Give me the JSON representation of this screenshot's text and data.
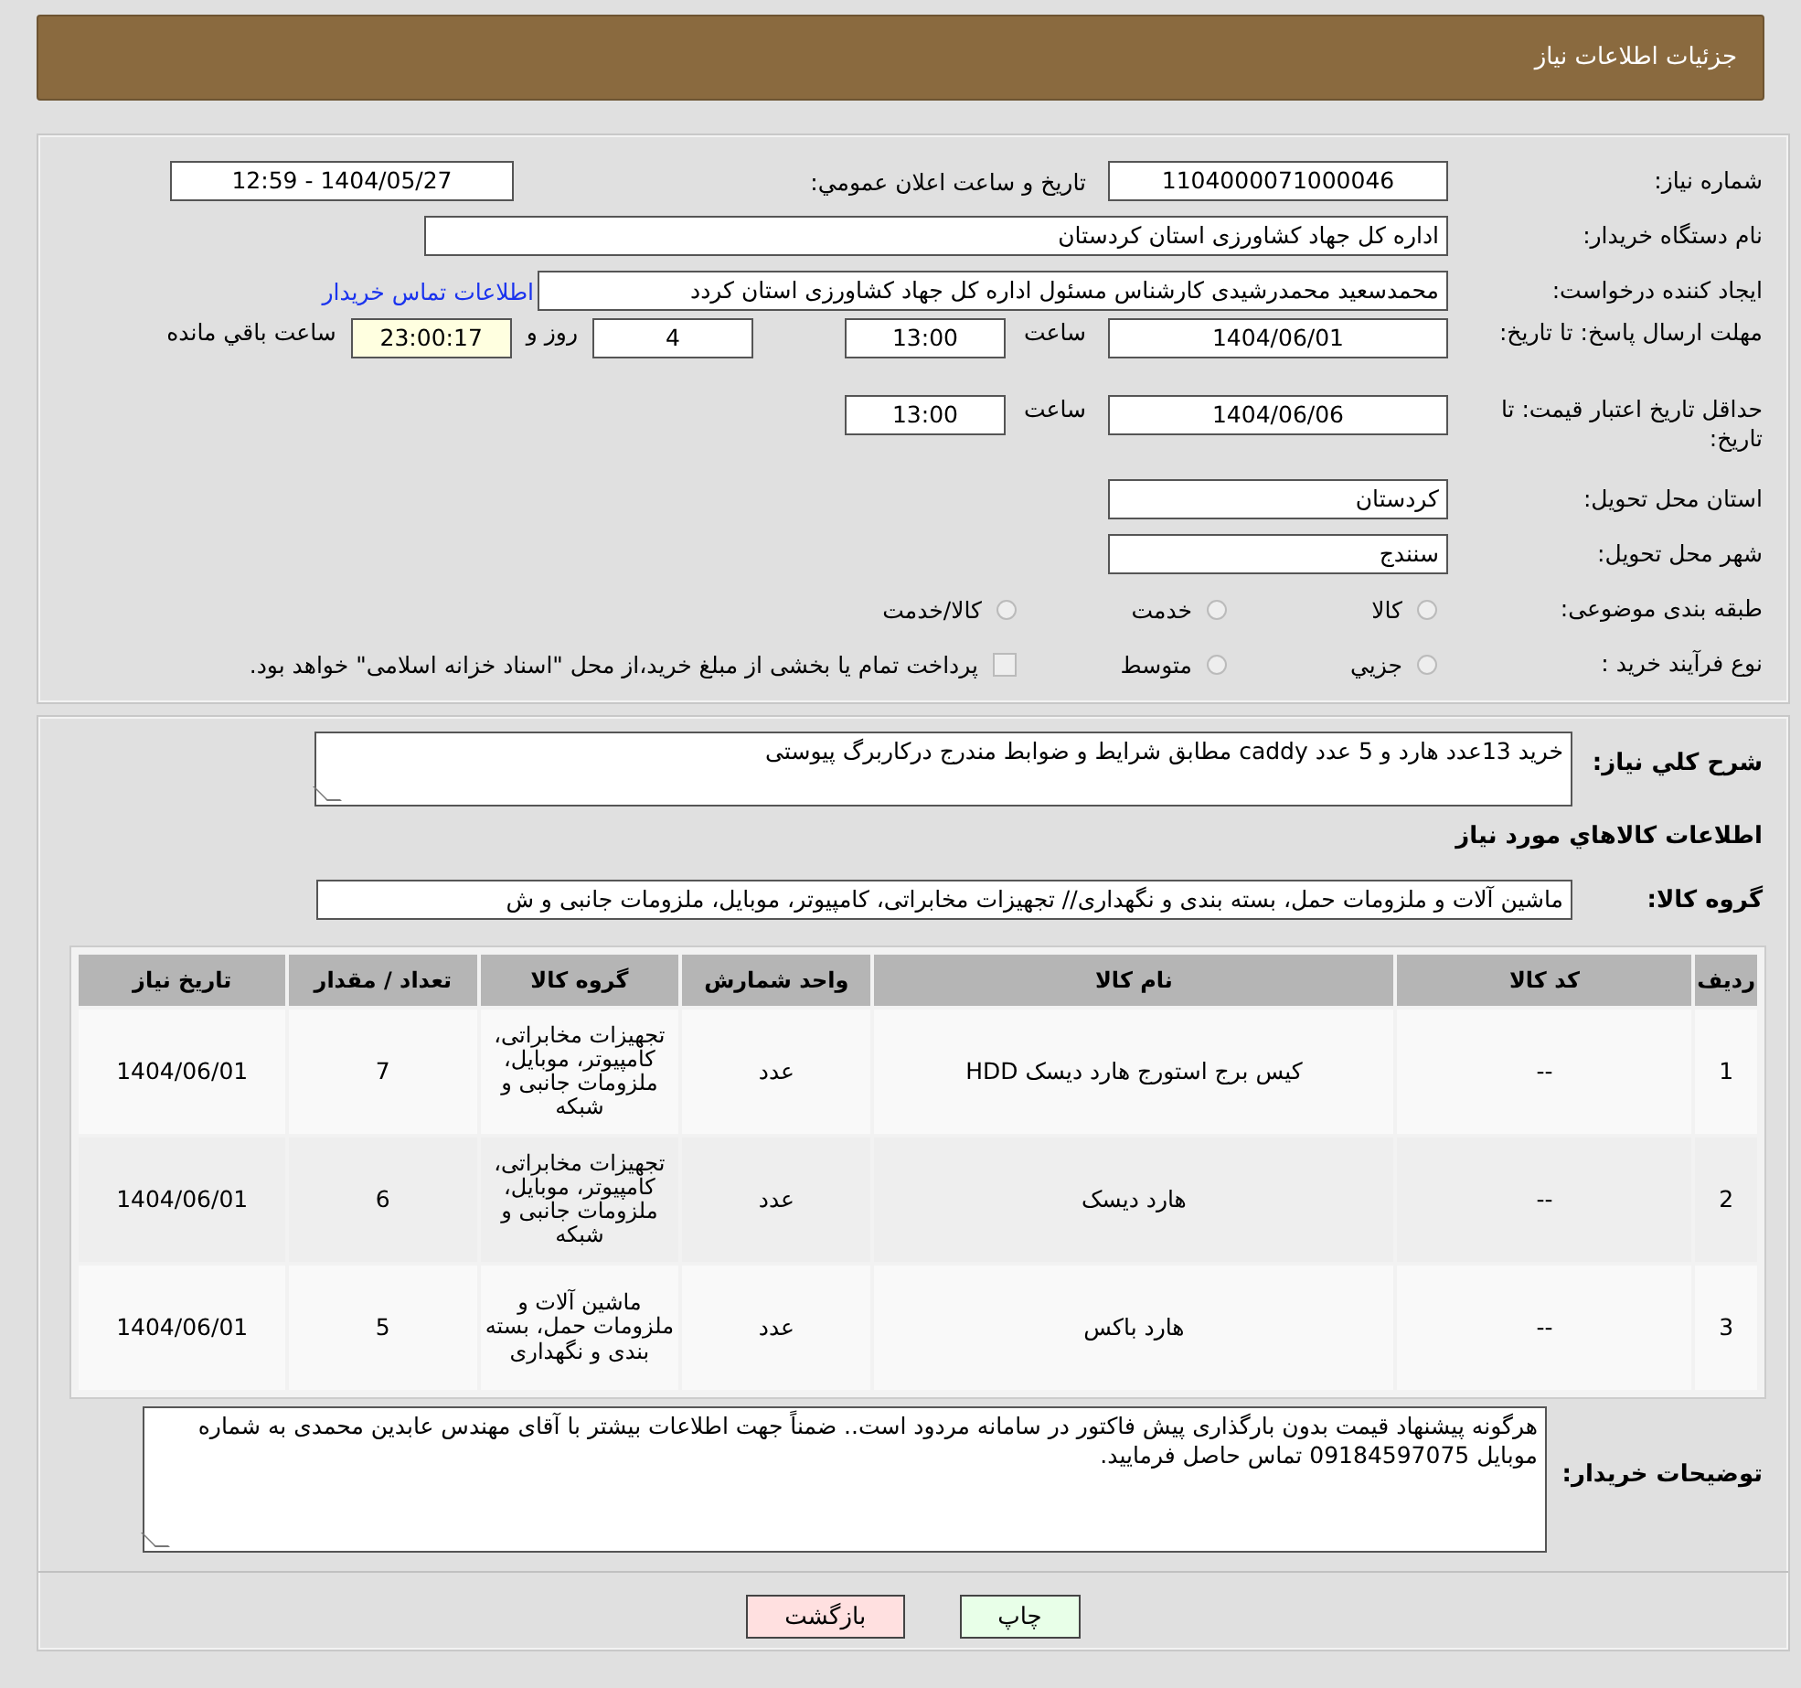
{
  "header": {
    "title": "جزئيات اطلاعات نياز"
  },
  "form": {
    "need_number": {
      "label": "شماره نياز:",
      "value": "1104000071000046"
    },
    "announce": {
      "label": "تاريخ و ساعت اعلان عمومي:",
      "value": "1404/05/27 - 12:59"
    },
    "buyer": {
      "label": "نام دستگاه خريدار:",
      "value": "اداره کل جهاد کشاورزی استان کردستان"
    },
    "creator": {
      "label": "ايجاد کننده درخواست:",
      "value": "محمدسعید محمدرشیدی کارشناس مسئول اداره کل جهاد کشاورزی استان کردد",
      "link": "اطلاعات تماس خريدار"
    },
    "deadline": {
      "label": "مهلت ارسال پاسخ: تا تاريخ:",
      "date": "1404/06/01",
      "time_label": "ساعت",
      "time": "13:00",
      "days": "4",
      "days_label": "روز و",
      "remaining": "23:00:17",
      "remaining_label": "ساعت باقي مانده"
    },
    "validity": {
      "label": "حداقل تاريخ اعتبار قيمت: تا تاريخ:",
      "date": "1404/06/06",
      "time_label": "ساعت",
      "time": "13:00"
    },
    "province": {
      "label": "استان محل تحويل:",
      "value": "کردستان"
    },
    "city": {
      "label": "شهر محل تحويل:",
      "value": "سنندج"
    },
    "category": {
      "label": "طبقه بندی موضوعی:",
      "options": [
        {
          "label": "کالا",
          "selected": false
        },
        {
          "label": "خدمت",
          "selected": false
        },
        {
          "label": "کالا/خدمت",
          "selected": false
        }
      ]
    },
    "process": {
      "label": "نوع فرآيند خريد :",
      "options": [
        {
          "label": "جزيي",
          "selected": false
        },
        {
          "label": "متوسط",
          "selected": false
        }
      ],
      "payment": {
        "label": "پرداخت تمام يا بخشی از مبلغ خريد،از محل \"اسناد خزانه اسلامی\" خواهد بود.",
        "checked": false
      }
    }
  },
  "details": {
    "summary_label": "شرح کلي نياز:",
    "summary": "خرید 13عدد هارد و 5 عدد caddy مطابق شرایط و ضوابط مندرج درکاربرگ پیوستی",
    "goods_heading": "اطلاعات کالاهاي مورد نياز",
    "group_label": "گروه کالا:",
    "group": "ماشین آلات و ملزومات حمل، بسته بندی و نگهداری// تجهیزات مخابراتی، کامپیوتر، موبایل، ملزومات جانبی و ش"
  },
  "table": {
    "columns": [
      "رديف",
      "کد کالا",
      "نام کالا",
      "واحد شمارش",
      "گروه کالا",
      "تعداد / مقدار",
      "تاريخ نياز"
    ],
    "rows": [
      [
        "1",
        "--",
        "کیس برج استورج هارد دیسک HDD",
        "عدد",
        "تجهیزات مخابراتی، کامپیوتر، موبایل، ملزومات جانبی و شبکه",
        "7",
        "1404/06/01"
      ],
      [
        "2",
        "--",
        "هارد دیسک",
        "عدد",
        "تجهیزات مخابراتی، کامپیوتر، موبایل، ملزومات جانبی و شبکه",
        "6",
        "1404/06/01"
      ],
      [
        "3",
        "--",
        "هارد باکس",
        "عدد",
        "ماشین آلات و ملزومات حمل، بسته بندی و نگهداری",
        "5",
        "1404/06/01"
      ]
    ]
  },
  "notes": {
    "label": "توضيحات خريدار:",
    "value": "هرگونه پیشنهاد قیمت بدون بارگذاری پیش فاکتور در سامانه مردود است.. ضمناً جهت اطلاعات بیشتر با آقای مهندس عابدین محمدی به شماره موبایل  09184597075 تماس حاصل فرمایید."
  },
  "buttons": [
    {
      "label": "چاپ",
      "kind": "print"
    },
    {
      "label": "بازگشت",
      "kind": "back"
    }
  ]
}
